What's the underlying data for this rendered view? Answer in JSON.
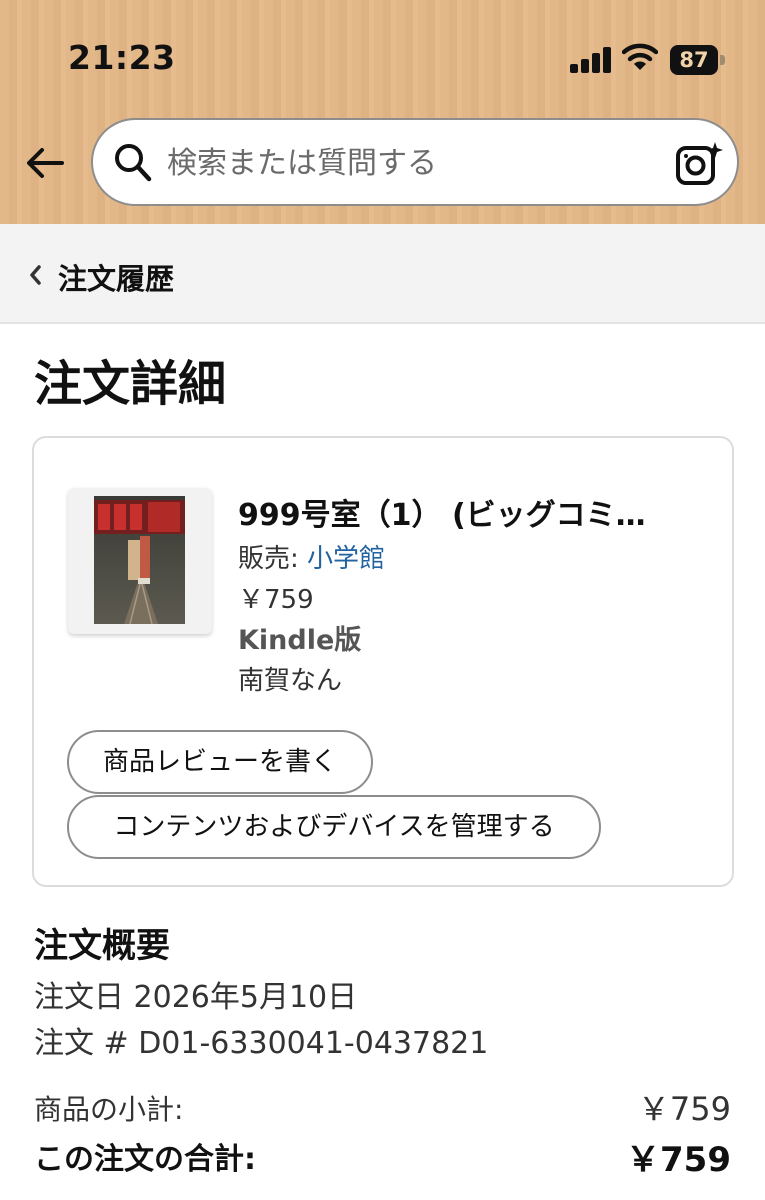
{
  "status_bar": {
    "time": "21:23",
    "battery": "87",
    "icons": [
      "signal-icon",
      "wifi-icon",
      "battery-icon"
    ]
  },
  "header": {
    "back_icon": "back-arrow-icon",
    "search_placeholder": "検索または質問する",
    "search_icon": "search-icon",
    "camera_icon": "camera-icon",
    "background_color": "#e3b889"
  },
  "breadcrumb": {
    "icon": "chevron-left-icon",
    "label": "注文履歴"
  },
  "page": {
    "title": "注文詳細"
  },
  "order_item": {
    "cover_image": "book-cover",
    "title": "999号室（1） (ビッグコミ…",
    "seller_prefix": "販売: ",
    "seller_name": "小学館",
    "price": "￥759",
    "format": "Kindle版",
    "author": "南賀なん",
    "buttons": {
      "review": "商品レビューを書く",
      "manage": "コンテンツおよびデバイスを管理する"
    }
  },
  "order_summary": {
    "heading": "注文概要",
    "order_date": "注文日 2026年5月10日",
    "order_number": "注文 # D01-6330041-0437821",
    "subtotal_label": "商品の小計:",
    "subtotal_value": "￥759",
    "total_label": "この注文の合計:",
    "total_value": "￥759"
  },
  "colors": {
    "link": "#2162a1",
    "text": "#0f1111",
    "breadcrumb_bg": "#f3f3f3"
  }
}
